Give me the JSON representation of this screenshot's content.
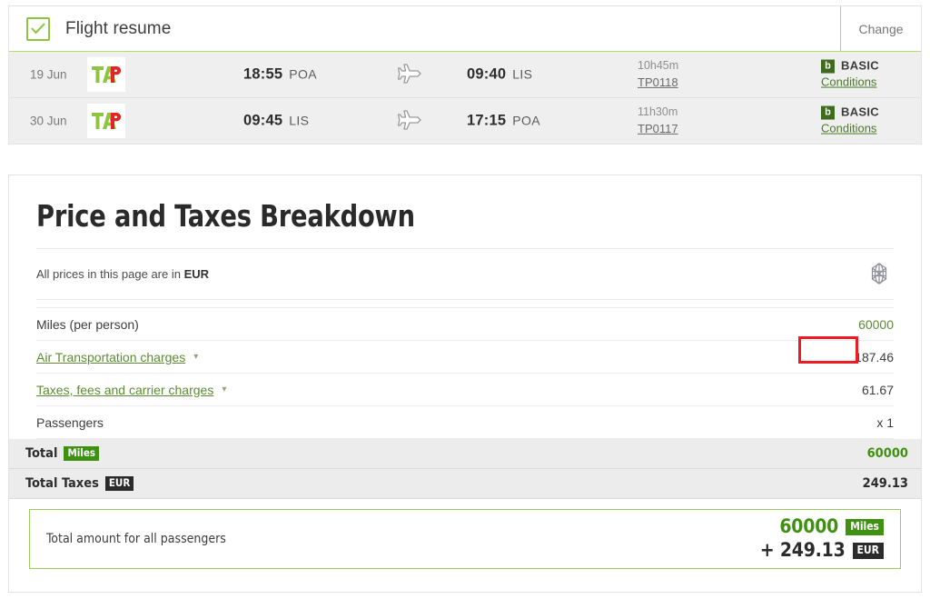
{
  "flight_resume": {
    "title": "Flight resume",
    "checkbox_checked": true,
    "change_label": "Change",
    "rows": [
      {
        "date": "19 Jun",
        "airline_logo": "tap-logo",
        "depart_time": "18:55",
        "depart_airport": "POA",
        "arrive_time": "09:40",
        "arrive_airport": "LIS",
        "duration": "10h45m",
        "flight_number": "TP0118",
        "fare_badge": "b",
        "fare_name": "BASIC",
        "conditions_label": "Conditions"
      },
      {
        "date": "30 Jun",
        "airline_logo": "tap-logo",
        "depart_time": "09:45",
        "depart_airport": "LIS",
        "arrive_time": "17:15",
        "arrive_airport": "POA",
        "duration": "11h30m",
        "flight_number": "TP0117",
        "fare_badge": "b",
        "fare_name": "BASIC",
        "conditions_label": "Conditions"
      }
    ]
  },
  "price_breakdown": {
    "title": "Price and Taxes Breakdown",
    "currency_note_prefix": "All prices in this page are in ",
    "currency_code": "EUR",
    "globe_icon": "globe-icon",
    "rows": [
      {
        "label": "Miles (per person)",
        "value": "60000",
        "link": false,
        "expandable": false,
        "value_color": "green"
      },
      {
        "label": "Air Transportation charges",
        "value": "187.46",
        "link": true,
        "expandable": true,
        "value_color": "dark",
        "highlighted": true
      },
      {
        "label": "Taxes, fees and carrier charges",
        "value": "61.67",
        "link": true,
        "expandable": true,
        "value_color": "dark"
      },
      {
        "label": "Passengers",
        "value": "x 1",
        "link": false,
        "expandable": false,
        "value_color": "dark"
      }
    ],
    "totals": [
      {
        "label": "Total",
        "badge": "Miles",
        "badge_type": "miles",
        "value": "60000",
        "value_color": "green"
      },
      {
        "label": "Total Taxes",
        "badge": "EUR",
        "badge_type": "eur",
        "value": "249.13",
        "value_color": "dark"
      }
    ],
    "grand_total": {
      "label": "Total amount for all passengers",
      "miles_value": "60000",
      "miles_badge": "Miles",
      "taxes_value": "+ 249.13",
      "taxes_badge": "EUR"
    }
  },
  "colors": {
    "accent_green": "#8cc63f",
    "link_green": "#5b8c33",
    "badge_green": "#3f9111",
    "badge_dark": "#2b2b2b",
    "highlight_red": "#ee1b24"
  }
}
